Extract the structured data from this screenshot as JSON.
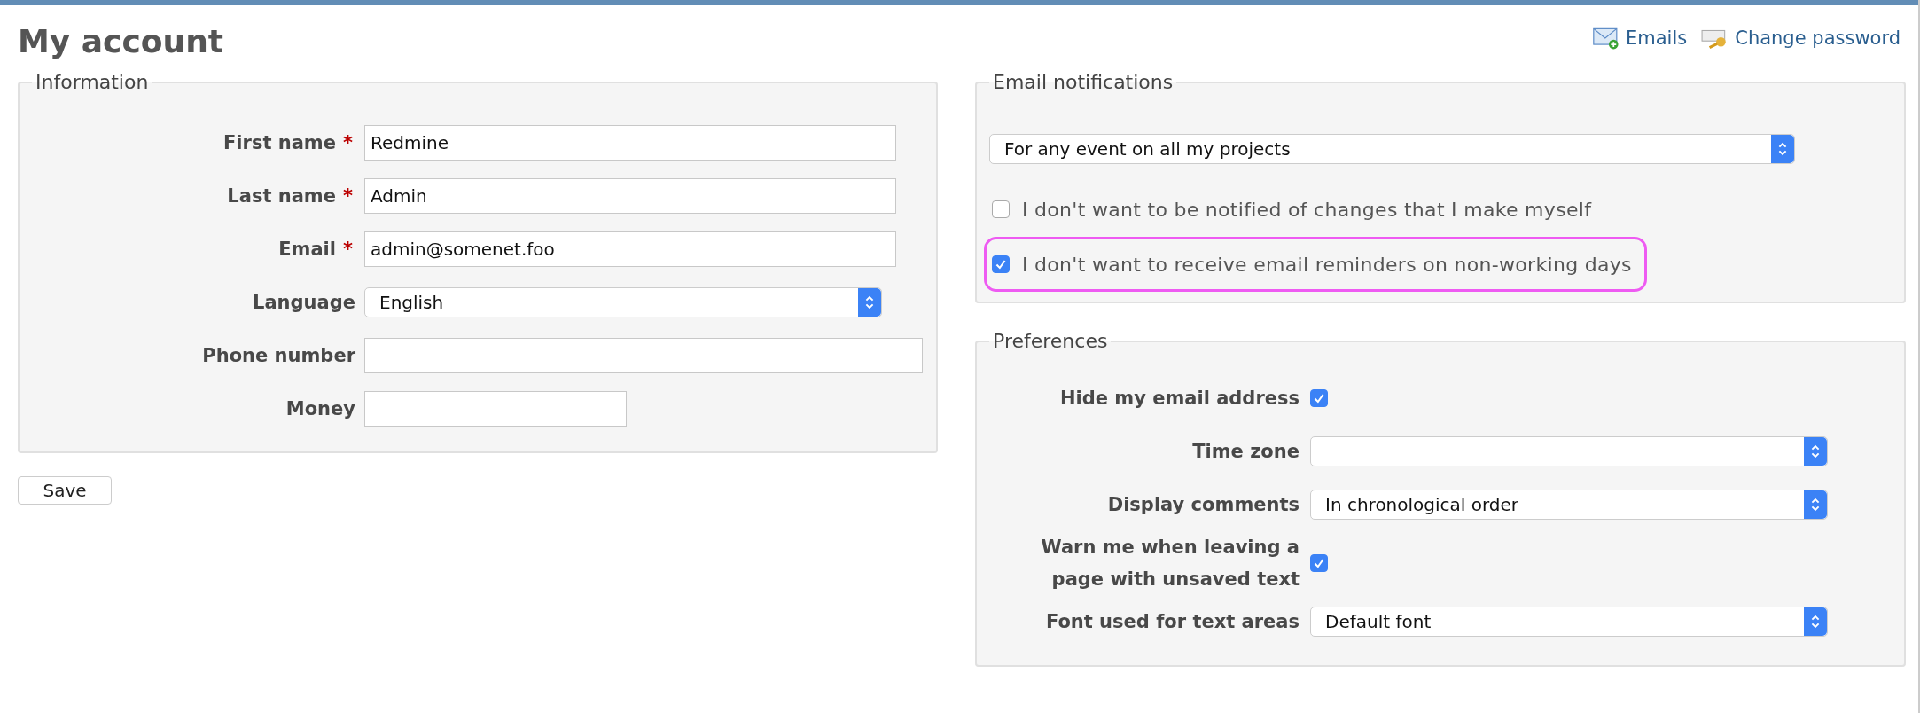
{
  "page_title": "My account",
  "header_links": [
    {
      "kind": "emails",
      "label": "Emails"
    },
    {
      "kind": "password",
      "label": "Change password"
    }
  ],
  "information": {
    "legend": "Information",
    "fields": [
      {
        "kind": "text",
        "label": "First name",
        "required": true,
        "value": "Redmine"
      },
      {
        "kind": "text",
        "label": "Last name",
        "required": true,
        "value": "Admin"
      },
      {
        "kind": "text",
        "label": "Email",
        "required": true,
        "value": "admin@somenet.foo"
      },
      {
        "kind": "select",
        "label": "Language",
        "required": false,
        "value": "English"
      },
      {
        "kind": "text",
        "label": "Phone number",
        "required": false
      },
      {
        "kind": "text",
        "label": "Money",
        "required": false
      }
    ],
    "required_mark": "*"
  },
  "save_button": "Save",
  "email_notifications": {
    "legend": "Email notifications",
    "select_value": "For any event on all my projects",
    "options": [
      {
        "label": "I don't want to be notified of changes that I make myself",
        "checked": false,
        "highlighted": false
      },
      {
        "label": "I don't want to receive email reminders on non-working days",
        "checked": true,
        "highlighted": true
      }
    ]
  },
  "preferences": {
    "legend": "Preferences",
    "rows": [
      {
        "kind": "checkbox",
        "label": "Hide my email address",
        "checked": true
      },
      {
        "kind": "select",
        "label": "Time zone"
      },
      {
        "kind": "select",
        "label": "Display comments",
        "value": "In chronological order"
      },
      {
        "kind": "checkbox",
        "label": "Warn me when leaving a page with unsaved text",
        "checked": true
      },
      {
        "kind": "select",
        "label": "Font used for text areas",
        "value": "Default font"
      }
    ]
  }
}
